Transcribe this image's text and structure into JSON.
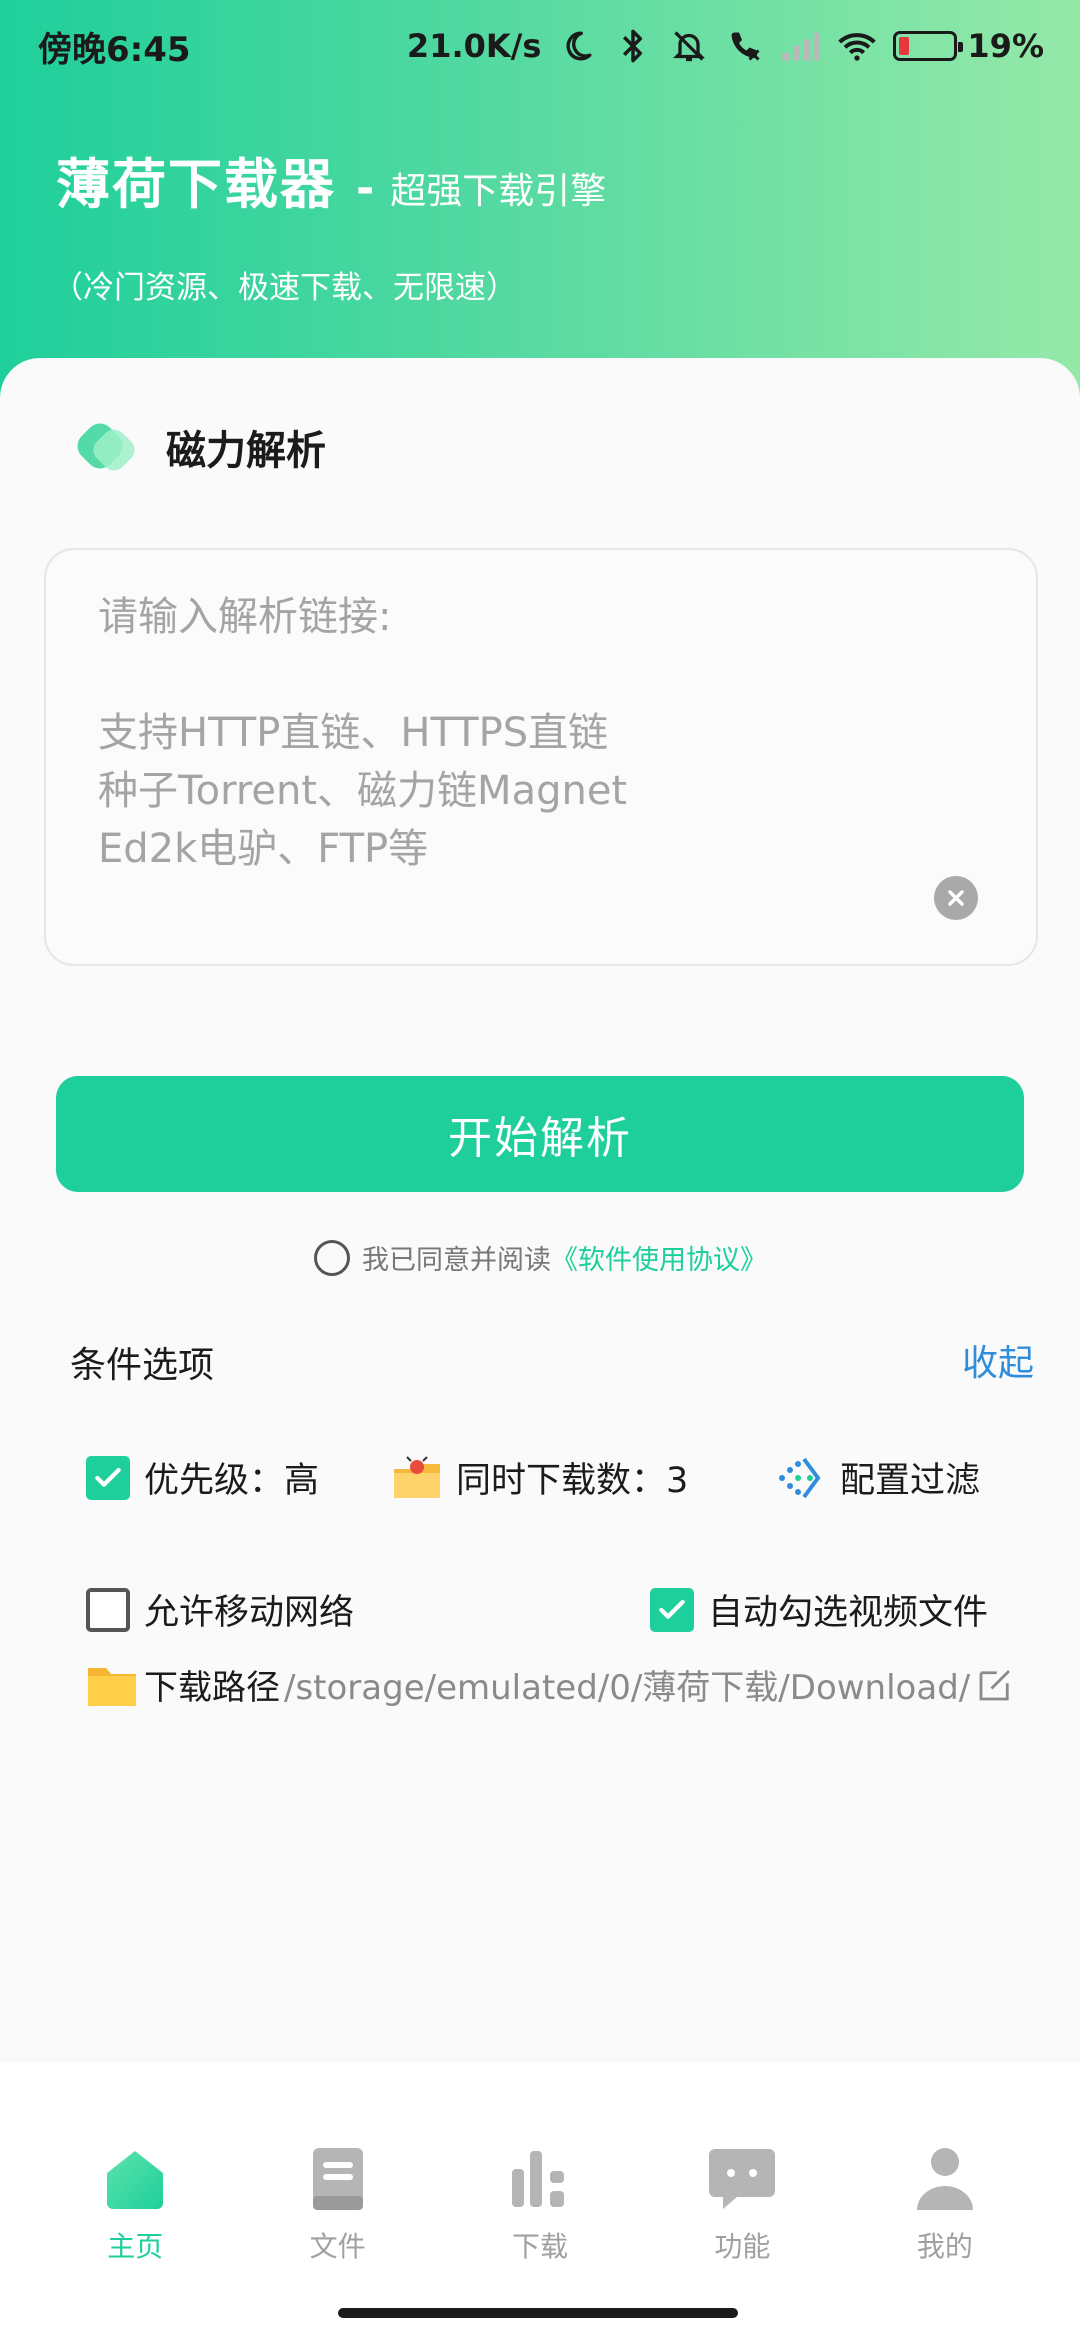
{
  "status_bar": {
    "time": "傍晚6:45",
    "network_speed": "21.0K/s",
    "battery": "19%",
    "battery_level": 0.19,
    "icons": [
      "moon-icon",
      "bluetooth-icon",
      "mute-bell-icon",
      "call-off-icon",
      "signal-icon",
      "wifi-icon",
      "battery-icon"
    ]
  },
  "header": {
    "app_name": "薄荷下载器",
    "dash": "-",
    "slogan": "超强下载引擎",
    "subtitle": "（冷门资源、极速下载、无限速）"
  },
  "parse_section": {
    "title": "磁力解析",
    "input_value": "",
    "placeholder": "请输入解析链接:\n\n支持HTTP直链、HTTPS直链\n种子Torrent、磁力链Magnet\nEd2k电驴、FTP等"
  },
  "start_button": "开始解析",
  "agreement": {
    "text": "我已同意并阅读",
    "link": "《软件使用协议》"
  },
  "options": {
    "title": "条件选项",
    "collapse": "收起",
    "priority": "优先级：高",
    "concurrent": "同时下载数：3",
    "filter": "配置过滤",
    "allow_mobile": "允许移动网络",
    "auto_select_video": "自动勾选视频文件",
    "path_label": "下载路径",
    "path_value": "/storage/emulated/0/薄荷下载/Download/"
  },
  "bottom_nav": {
    "items": [
      {
        "label": "主页",
        "icon": "home-icon",
        "active": true
      },
      {
        "label": "文件",
        "icon": "book-icon",
        "active": false
      },
      {
        "label": "下载",
        "icon": "bar-chart-icon",
        "active": false
      },
      {
        "label": "功能",
        "icon": "chat-icon",
        "active": false
      },
      {
        "label": "我的",
        "icon": "user-icon",
        "active": false
      }
    ]
  },
  "colors": {
    "accent": "#1ecf9b",
    "link_blue": "#2f8ddc",
    "header_gradient_start": "#1fcf9b",
    "header_gradient_end": "#95e9a8"
  }
}
